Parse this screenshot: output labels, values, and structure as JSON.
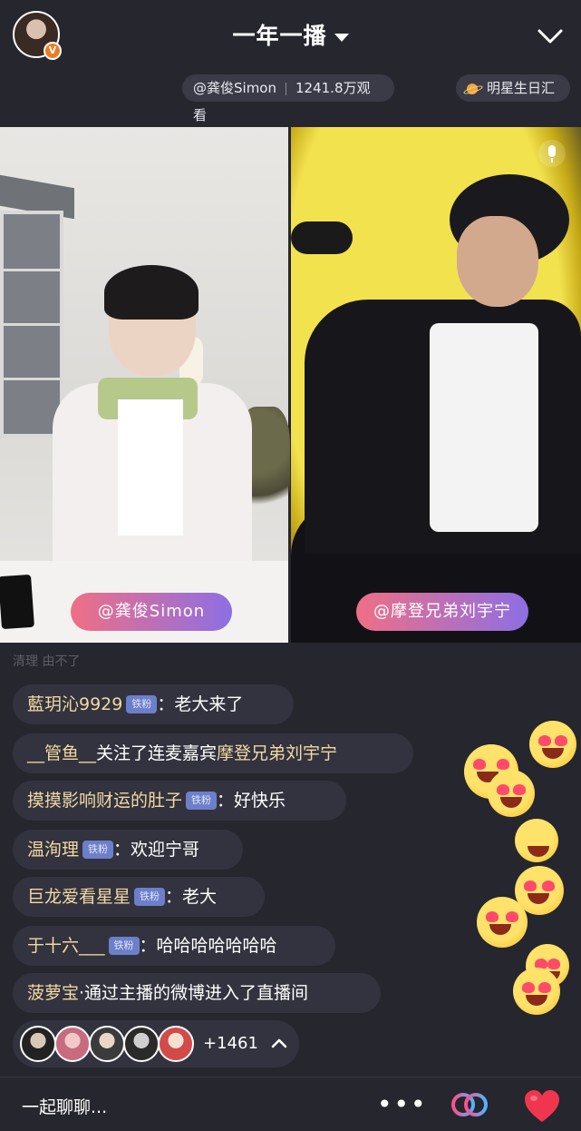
{
  "header": {
    "title": "一年一播",
    "host_badge": "V",
    "host_tag": "@龚俊Simon",
    "views": "1241.8万观看",
    "birthday_tag": "明星生日汇"
  },
  "videos": {
    "left_name": "@龚俊Simon",
    "right_name": "@摩登兄弟刘宇宁"
  },
  "chat": {
    "ghost_line": "清理     由不了",
    "messages": [
      {
        "user": "藍玥沁9929",
        "badge": "铁粉",
        "sep": "：",
        "text": "老大来了"
      },
      {
        "user": "__管鱼__",
        "text": "关注了连麦嘉宾",
        "guest": "摩登兄弟刘宇宁"
      },
      {
        "user": "摸摸影响财运的肚子",
        "badge": "铁粉",
        "sep": "：",
        "text": "好快乐"
      },
      {
        "user": "温洵理",
        "badge": "铁粉",
        "sep": "：",
        "text": "欢迎宁哥"
      },
      {
        "user": "巨龙爱看星星",
        "badge": "铁粉",
        "sep": "：",
        "text": "老大"
      },
      {
        "user": "于十六___",
        "badge": "铁粉",
        "sep": "：",
        "text": "哈哈哈哈哈哈哈"
      },
      {
        "user": "菠萝宝",
        "text": "·通过主播的微博进入了直播间"
      }
    ]
  },
  "viewers": {
    "count": "+1461"
  },
  "bottom": {
    "input_placeholder": "一起聊聊...",
    "more": "•••"
  },
  "icons": {
    "collapse": "chevron-down-icon",
    "mic": "mic-icon",
    "expand": "chevron-up-icon",
    "link": "link-mic-icon",
    "like": "heart-icon"
  },
  "colors": {
    "background": "#26262f",
    "name_tag_start": "#ef6f86",
    "name_tag_end": "#8d6fe3",
    "fan_badge": "#6c7fc8",
    "heart": "#f0364f"
  }
}
